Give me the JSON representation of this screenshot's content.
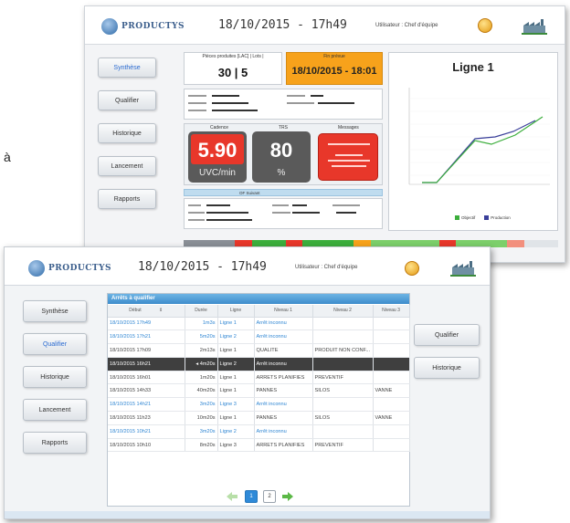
{
  "side_glyph": "à",
  "back": {
    "logo": "PRODUCTYS",
    "date": "18/10/2015 - 17h49",
    "user": "Utilisateur : Chef d'équipe",
    "nav": [
      "Synthèse",
      "Qualifier",
      "Historique",
      "Lancement",
      "Rapports"
    ],
    "production_label": "Pièces produites [LAC] | Lots |",
    "production_value": "30 | 5",
    "end_label": "Fin prévue",
    "end_value": "18/10/2015 - 18:01",
    "chart_title": "Ligne 1",
    "cadence_label": "Cadence",
    "cadence_value": "5.90",
    "cadence_unit": "UVC/min",
    "trs_label": "TRS",
    "trs_value": "80",
    "trs_unit": "%",
    "messages_label": "Messages",
    "of_suivant": "OF Suivant",
    "legend": [
      "Objectif",
      "Production"
    ]
  },
  "front": {
    "logo": "PRODUCTYS",
    "date": "18/10/2015 - 17h49",
    "user": "Utilisateur : Chef d'équipe",
    "nav": [
      "Synthèse",
      "Qualifier",
      "Historique",
      "Lancement",
      "Rapports"
    ],
    "table_title": "Arrêts à qualifier",
    "columns": [
      "Début",
      "Durée",
      "Ligne",
      "Niveau 1",
      "Niveau 2",
      "Niveau 3"
    ],
    "rows": [
      {
        "debut": "18/10/2015 17h49",
        "duree": "1m3s",
        "ligne": "Ligne 1",
        "n1": "Arrêt inconnu",
        "n2": "",
        "n3": "",
        "style": "blue"
      },
      {
        "debut": "18/10/2015 17h21",
        "duree": "5m20s",
        "ligne": "Ligne 2",
        "n1": "Arrêt inconnu",
        "n2": "",
        "n3": "",
        "style": "blue"
      },
      {
        "debut": "18/10/2015 17h09",
        "duree": "2m13s",
        "ligne": "Ligne 1",
        "n1": "QUALITE",
        "n2": "PRODUIT NON CONF...",
        "n3": "",
        "style": "normal"
      },
      {
        "debut": "18/10/2015 16h21",
        "duree": "4m20s",
        "ligne": "Ligne 2",
        "n1": "Arrêt inconnu",
        "n2": "",
        "n3": "",
        "style": "sel"
      },
      {
        "debut": "18/10/2015 16h01",
        "duree": "1m20s",
        "ligne": "Ligne 1",
        "n1": "ARRETS PLANIFIES",
        "n2": "PREVENTIF",
        "n3": "",
        "style": "normal"
      },
      {
        "debut": "18/10/2015 14h33",
        "duree": "40m20s",
        "ligne": "Ligne 1",
        "n1": "PANNES",
        "n2": "SILOS",
        "n3": "VANNE",
        "style": "normal"
      },
      {
        "debut": "18/10/2015 14h21",
        "duree": "3m20s",
        "ligne": "Ligne 3",
        "n1": "Arrêt inconnu",
        "n2": "",
        "n3": "",
        "style": "blue"
      },
      {
        "debut": "18/10/2015 11h23",
        "duree": "10m20s",
        "ligne": "Ligne 1",
        "n1": "PANNES",
        "n2": "SILOS",
        "n3": "VANNE",
        "style": "normal"
      },
      {
        "debut": "18/10/2015 10h21",
        "duree": "3m20s",
        "ligne": "Ligne 2",
        "n1": "Arrêt inconnu",
        "n2": "",
        "n3": "",
        "style": "blue"
      },
      {
        "debut": "18/10/2015 10h10",
        "duree": "8m20s",
        "ligne": "Ligne 3",
        "n1": "ARRETS PLANIFIES",
        "n2": "PREVENTIF",
        "n3": "",
        "style": "normal"
      }
    ],
    "pages": [
      "1",
      "2"
    ],
    "actions": [
      "Qualifier",
      "Historique"
    ]
  },
  "colors": {
    "orange": "#f7a21b",
    "red": "#e8372a",
    "dark_tile": "#5a5a5a",
    "blue_accent": "#2f86d3",
    "green": "#3cae3c",
    "navy": "#3a3f9a"
  }
}
